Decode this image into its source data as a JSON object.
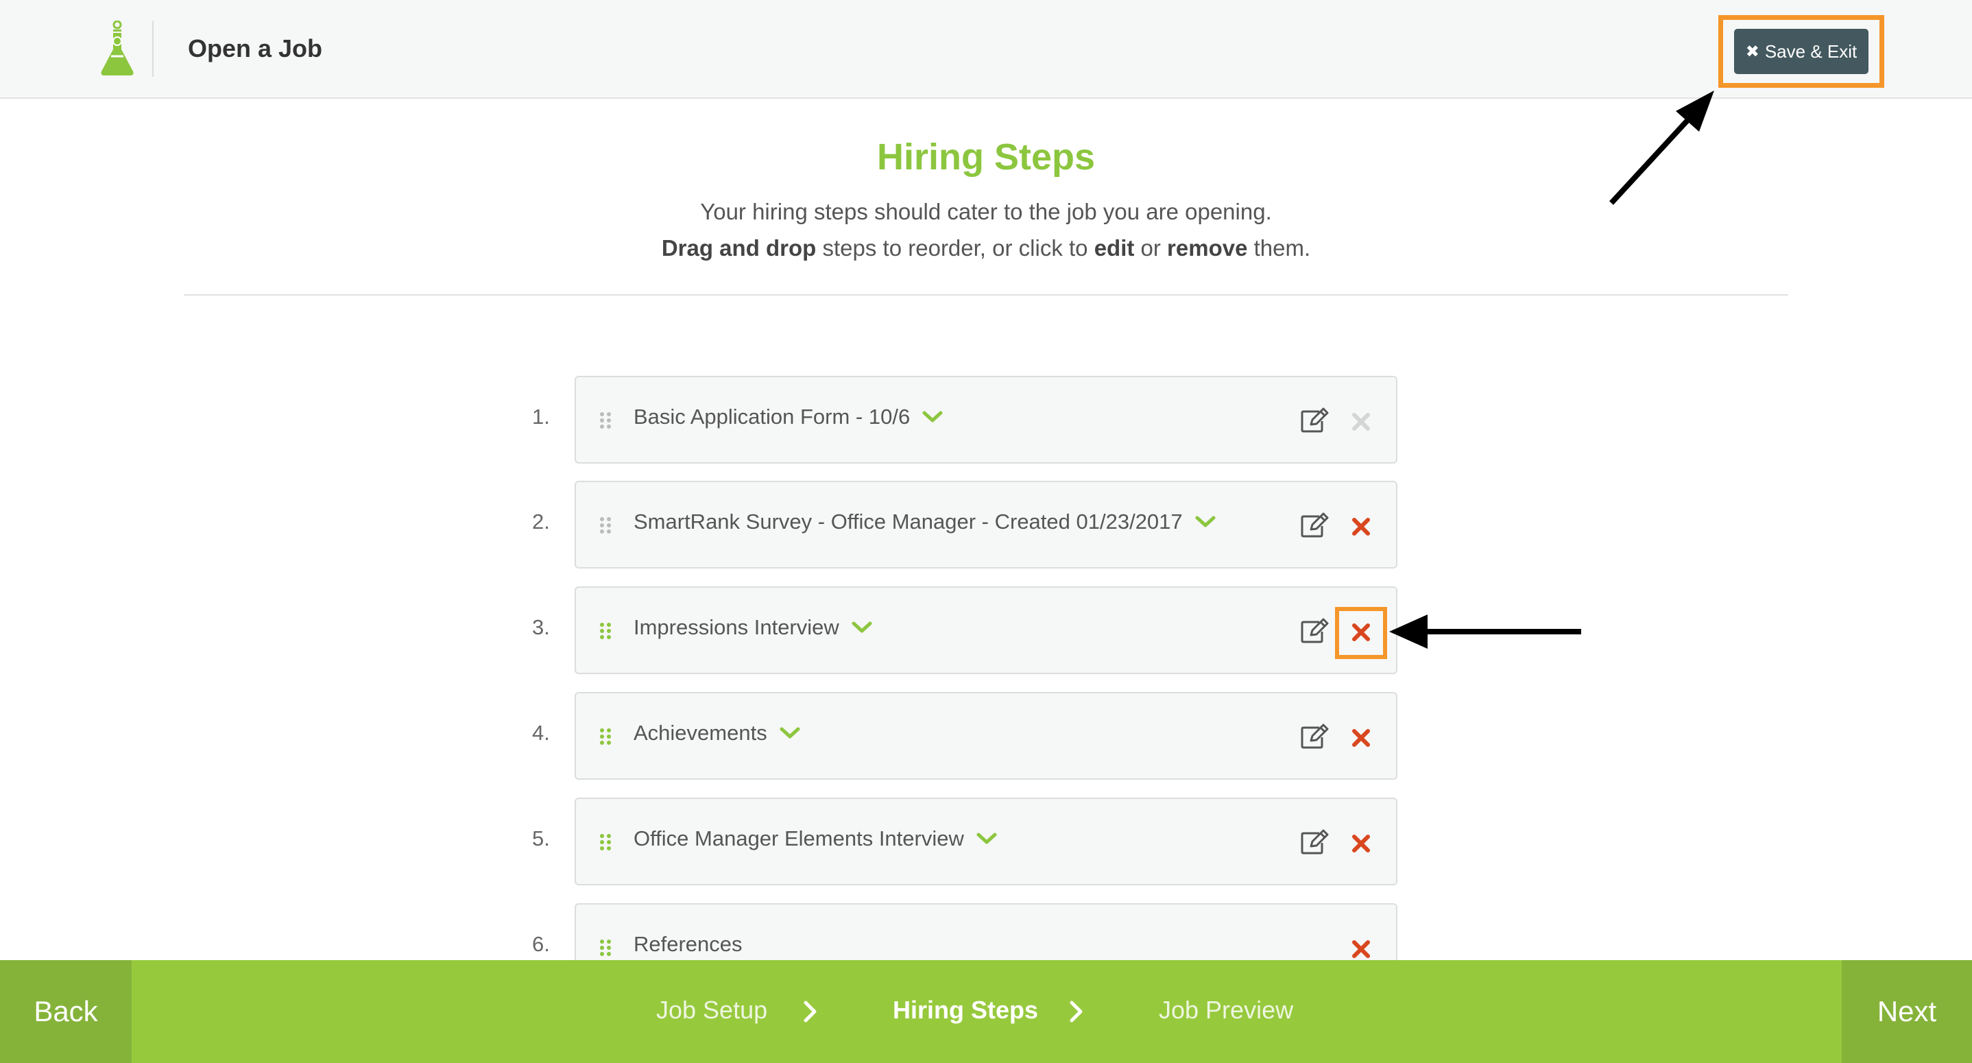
{
  "header": {
    "title": "Open a Job",
    "save_exit_label": "Save & Exit"
  },
  "intro": {
    "title": "Hiring Steps",
    "line1": "Your hiring steps should cater to the job you are opening.",
    "line2": {
      "drag": "Drag and drop",
      "t1": " steps to reorder, or click to ",
      "edit": "edit",
      "t2": " or ",
      "remove": "remove",
      "t3": " them."
    }
  },
  "steps": [
    {
      "num": "1.",
      "name": "Basic Application Form - 10/6",
      "expandable": true,
      "editable": true,
      "removable": false
    },
    {
      "num": "2.",
      "name": "SmartRank Survey - Office Manager - Created 01/23/2017",
      "expandable": true,
      "editable": true,
      "removable": true
    },
    {
      "num": "3.",
      "name": "Impressions Interview",
      "expandable": true,
      "editable": true,
      "removable": true,
      "highlighted": true
    },
    {
      "num": "4.",
      "name": "Achievements",
      "expandable": true,
      "editable": true,
      "removable": true
    },
    {
      "num": "5.",
      "name": "Office Manager Elements Interview",
      "expandable": true,
      "editable": true,
      "removable": true
    },
    {
      "num": "6.",
      "name": "References",
      "expandable": false,
      "editable": false,
      "removable": true
    }
  ],
  "footer": {
    "back": "Back",
    "next": "Next",
    "crumbs": [
      "Job Setup",
      "Hiring Steps",
      "Job Preview"
    ],
    "active_crumb": "Hiring Steps"
  },
  "colors": {
    "brand_green": "#8cc63f",
    "footer_green": "#97c93d",
    "button_dark": "#43585f",
    "delete_red": "#d9471f",
    "highlight_orange": "#f5962a"
  },
  "icons": {
    "logo": "flask-icon",
    "grip": "drag-grip-icon",
    "expand": "chevron-down-icon",
    "edit": "edit-icon",
    "remove": "close-icon",
    "crumb_separator": "chevron-right-icon"
  }
}
